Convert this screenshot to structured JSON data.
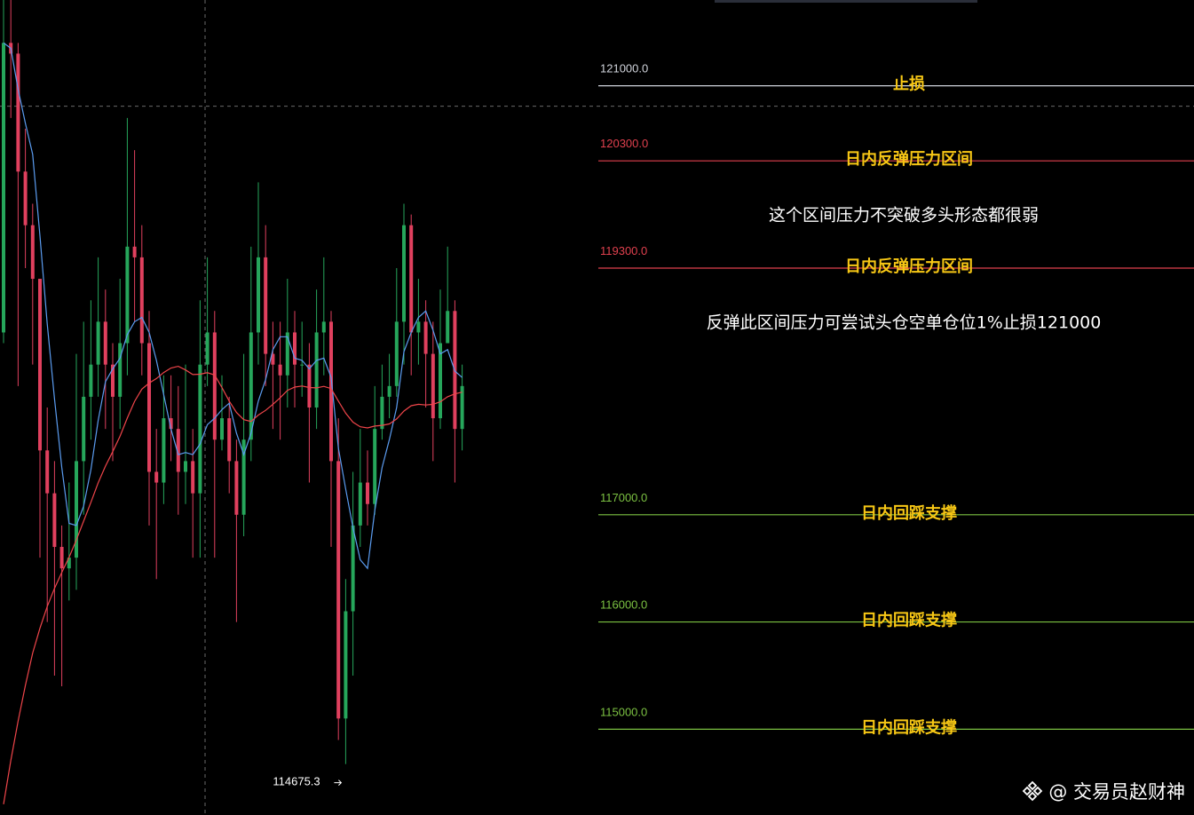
{
  "chart_data": {
    "type": "candlestick",
    "y_axis": {
      "min": 114200,
      "max": 121800
    },
    "crosshair_price": 120810,
    "levels": [
      {
        "price": 121000,
        "label": "121000.0",
        "title": "止损",
        "line_color": "#d1d4dc",
        "label_color": "#d1d4dc"
      },
      {
        "price": 120300,
        "label": "120300.0",
        "title": "日内反弹压力区间",
        "line_color": "#e0404e",
        "label_color": "#e0404e"
      },
      {
        "price": 119300,
        "label": "119300.0",
        "title": "日内反弹压力区间",
        "line_color": "#e0404e",
        "label_color": "#e0404e"
      },
      {
        "price": 117000,
        "label": "117000.0",
        "title": "日内回踩支撑",
        "line_color": "#7cc242",
        "label_color": "#7cc242"
      },
      {
        "price": 116000,
        "label": "116000.0",
        "title": "日内回踩支撑",
        "line_color": "#7cc242",
        "label_color": "#7cc242"
      },
      {
        "price": 115000,
        "label": "115000.0",
        "title": "日内回踩支撑",
        "line_color": "#7cc242",
        "label_color": "#7cc242"
      }
    ],
    "notes": [
      {
        "text": "这个区间压力不突破多头形态都很弱",
        "price": 119800
      },
      {
        "text": "反弹此区间压力可尝试头仓空单仓位1%止损121000",
        "price": 118800
      }
    ],
    "low_marker": {
      "price": 114675.3,
      "label": "114675.3"
    },
    "colors": {
      "up": "#26a65b",
      "down": "#e0405e",
      "ma_fast": "#5b9cf0",
      "ma_slow": "#f0454a",
      "grid": "#6a6a6a"
    },
    "candles": [
      [
        118700,
        121400,
        121900,
        118600
      ],
      [
        121400,
        121300,
        121900,
        120700
      ],
      [
        121300,
        120200,
        121400,
        118200
      ],
      [
        120200,
        119700,
        120600,
        119300
      ],
      [
        119700,
        119200,
        119900,
        118400
      ],
      [
        119200,
        117600,
        119200,
        116600
      ],
      [
        117600,
        117200,
        118000,
        116000
      ],
      [
        117200,
        116700,
        117500,
        115500
      ],
      [
        116700,
        116500,
        116900,
        115400
      ],
      [
        116500,
        116600,
        117300,
        116200
      ],
      [
        116600,
        117500,
        118500,
        116300
      ],
      [
        117500,
        118100,
        118800,
        117000
      ],
      [
        118100,
        118400,
        119000,
        117700
      ],
      [
        118400,
        118800,
        119400,
        118100
      ],
      [
        118800,
        118400,
        119100,
        117800
      ],
      [
        118400,
        118100,
        118600,
        117500
      ],
      [
        118100,
        118600,
        119200,
        117800
      ],
      [
        118600,
        119500,
        120700,
        118300
      ],
      [
        119500,
        119400,
        120400,
        118800
      ],
      [
        119400,
        118600,
        119700,
        118300
      ],
      [
        118600,
        117400,
        118900,
        116900
      ],
      [
        117400,
        117300,
        117800,
        116400
      ],
      [
        117300,
        117900,
        118300,
        117100
      ],
      [
        117900,
        117800,
        118300,
        117500
      ],
      [
        117800,
        117400,
        118200,
        117000
      ],
      [
        117400,
        117500,
        118400,
        117100
      ],
      [
        117500,
        117200,
        117800,
        116600
      ],
      [
        117200,
        118400,
        119000,
        116600
      ],
      [
        118400,
        118700,
        119400,
        118200
      ],
      [
        118700,
        117700,
        118900,
        116600
      ],
      [
        117700,
        117900,
        118300,
        117600
      ],
      [
        117900,
        117500,
        118100,
        117200
      ],
      [
        117500,
        117000,
        117700,
        116000
      ],
      [
        117000,
        117700,
        118500,
        116800
      ],
      [
        117700,
        118700,
        119500,
        117500
      ],
      [
        118700,
        119400,
        120100,
        118400
      ],
      [
        119400,
        118500,
        119700,
        118200
      ],
      [
        118500,
        118400,
        118800,
        117800
      ],
      [
        118400,
        118300,
        118800,
        117700
      ],
      [
        118300,
        118700,
        119200,
        118000
      ],
      [
        118700,
        118400,
        118900,
        118000
      ],
      [
        118400,
        118400,
        118800,
        118100
      ],
      [
        118400,
        118000,
        118600,
        117300
      ],
      [
        118000,
        118700,
        119100,
        117800
      ],
      [
        118700,
        118800,
        119400,
        118300
      ],
      [
        118800,
        117500,
        118900,
        116700
      ],
      [
        117500,
        115100,
        117900,
        114900
      ],
      [
        115100,
        116100,
        116400,
        114675.3
      ],
      [
        116100,
        116900,
        117400,
        115500
      ],
      [
        116900,
        117300,
        117800,
        116700
      ],
      [
        117300,
        117100,
        117600,
        116900
      ],
      [
        117100,
        117800,
        118200,
        117000
      ],
      [
        117800,
        118100,
        118400,
        117700
      ],
      [
        118100,
        118200,
        118500,
        117900
      ],
      [
        118200,
        118800,
        119300,
        118100
      ],
      [
        118800,
        119700,
        119900,
        118400
      ],
      [
        119700,
        118700,
        119800,
        118300
      ],
      [
        118700,
        118800,
        119200,
        118400
      ],
      [
        118800,
        118500,
        119000,
        118000
      ],
      [
        118500,
        117900,
        118800,
        117500
      ],
      [
        117900,
        118600,
        119100,
        117800
      ],
      [
        118600,
        118900,
        119500,
        118600
      ],
      [
        118900,
        117800,
        119000,
        117300
      ],
      [
        117800,
        118200,
        118400,
        117600
      ]
    ]
  },
  "watermark": {
    "text": "@ 交易员赵财神",
    "icon": "binance-diamond-icon"
  }
}
